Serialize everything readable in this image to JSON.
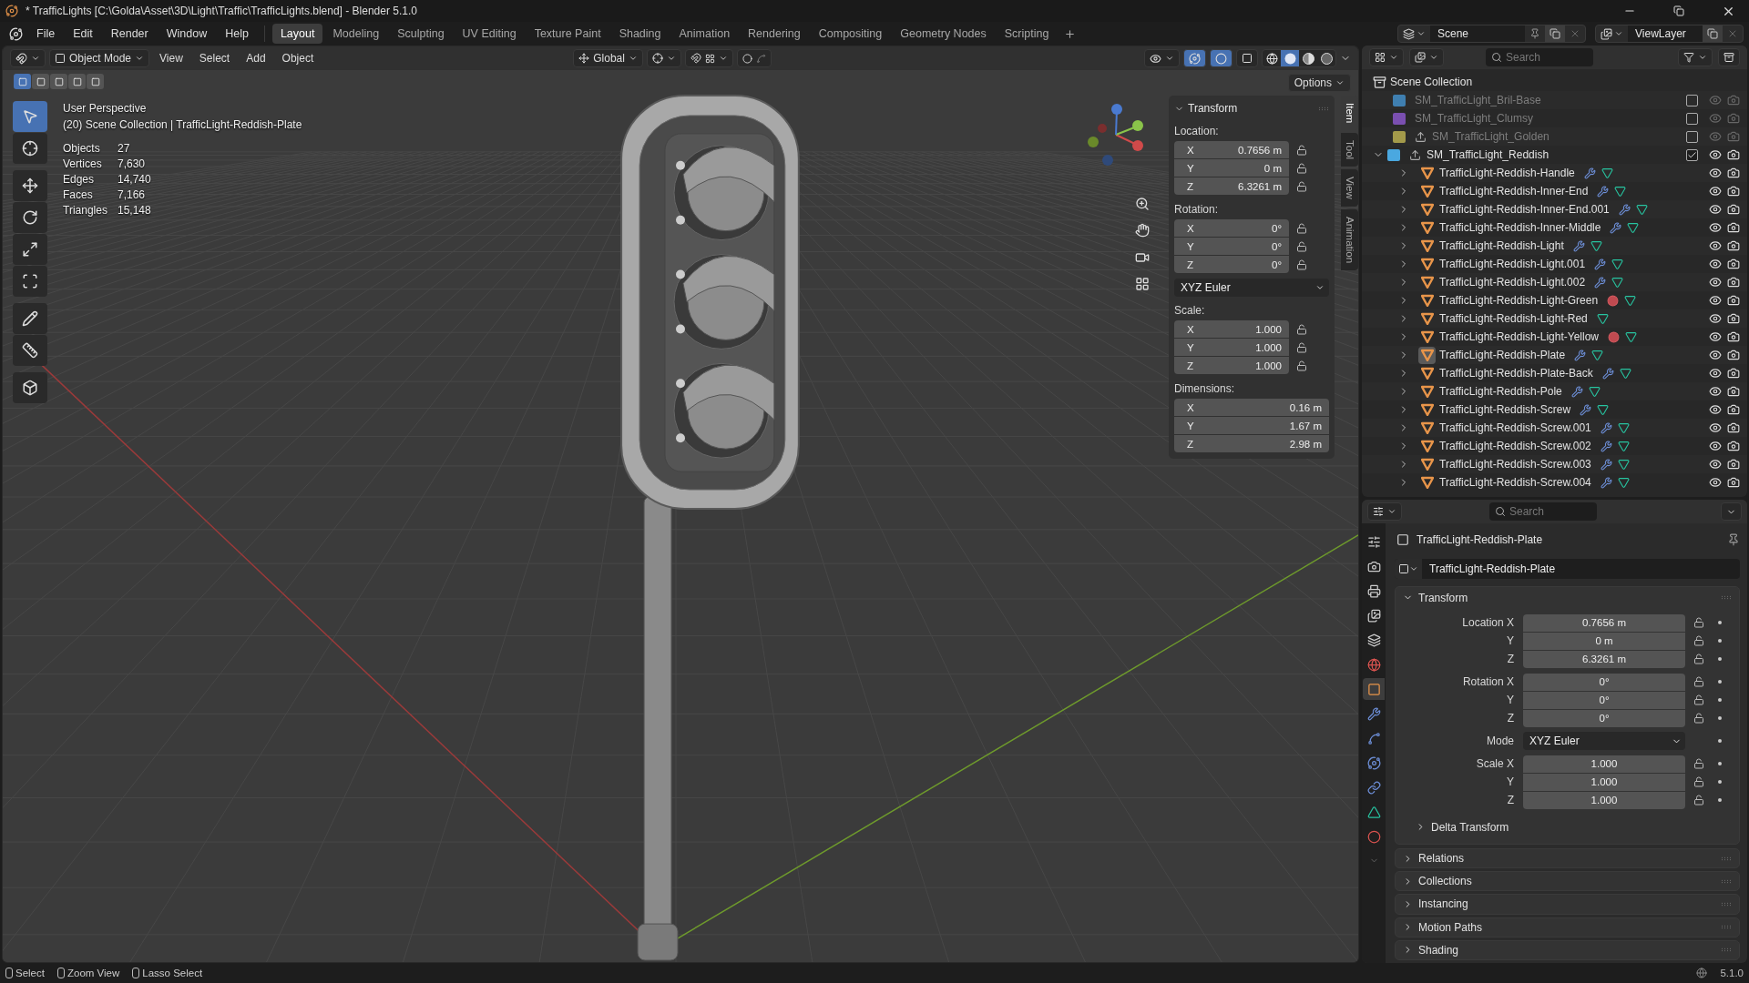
{
  "window": {
    "title": "* TrafficLights [C:\\Golda\\Asset\\3D\\Light\\Traffic\\TrafficLights.blend] - Blender 5.1.0"
  },
  "menu": [
    "File",
    "Edit",
    "Render",
    "Window",
    "Help"
  ],
  "workspaces": [
    {
      "label": "Layout",
      "selected": true
    },
    {
      "label": "Modeling",
      "selected": false
    },
    {
      "label": "Sculpting",
      "selected": false
    },
    {
      "label": "UV Editing",
      "selected": false
    },
    {
      "label": "Texture Paint",
      "selected": false
    },
    {
      "label": "Shading",
      "selected": false
    },
    {
      "label": "Animation",
      "selected": false
    },
    {
      "label": "Rendering",
      "selected": false
    },
    {
      "label": "Compositing",
      "selected": false
    },
    {
      "label": "Geometry Nodes",
      "selected": false
    },
    {
      "label": "Scripting",
      "selected": false
    }
  ],
  "scene_selector": {
    "scene": "Scene",
    "view_layer": "ViewLayer"
  },
  "viewport": {
    "mode": "Object Mode",
    "menus": [
      "View",
      "Select",
      "Add",
      "Object"
    ],
    "orientation": "Global",
    "options": "Options",
    "shading": [
      {
        "kind": "wireframe",
        "selected": false
      },
      {
        "kind": "solid",
        "selected": true
      },
      {
        "kind": "material",
        "selected": false
      },
      {
        "kind": "rendered",
        "selected": false
      }
    ],
    "select_modes": [
      {
        "selected": true
      },
      {
        "selected": false
      },
      {
        "selected": false
      },
      {
        "selected": false
      },
      {
        "selected": false
      }
    ],
    "tools": [
      {
        "kind": "select",
        "selected": true
      },
      {
        "kind": "cursor",
        "selected": false
      },
      {
        "kind": "move",
        "selected": false
      },
      {
        "kind": "rotate",
        "selected": false
      },
      {
        "kind": "scale",
        "selected": false
      },
      {
        "kind": "transform",
        "selected": false
      },
      {
        "kind": "annotate",
        "selected": false
      },
      {
        "kind": "measure",
        "selected": false
      },
      {
        "kind": "add_cube",
        "selected": false
      }
    ],
    "view_name": "User Perspective",
    "context": "(20) Scene Collection | TrafficLight-Reddish-Plate",
    "stats": [
      {
        "label": "Objects",
        "value": "27"
      },
      {
        "label": "Vertices",
        "value": "7,630"
      },
      {
        "label": "Edges",
        "value": "14,740"
      },
      {
        "label": "Faces",
        "value": "7,166"
      },
      {
        "label": "Triangles",
        "value": "15,148"
      }
    ]
  },
  "sidebar": {
    "tabs": [
      {
        "label": "Item",
        "selected": true
      },
      {
        "label": "Tool",
        "selected": false
      },
      {
        "label": "View",
        "selected": false
      },
      {
        "label": "Animation",
        "selected": false
      }
    ],
    "panel_title": "Transform",
    "groups": [
      {
        "label": "Location:",
        "lockable": true,
        "rows": [
          {
            "axis": "X",
            "value": "0.7656 m"
          },
          {
            "axis": "Y",
            "value": "0 m"
          },
          {
            "axis": "Z",
            "value": "6.3261 m"
          }
        ]
      },
      {
        "label": "Rotation:",
        "lockable": true,
        "rows": [
          {
            "axis": "X",
            "value": "0°"
          },
          {
            "axis": "Y",
            "value": "0°"
          },
          {
            "axis": "Z",
            "value": "0°"
          }
        ],
        "mode": "XYZ Euler"
      },
      {
        "label": "Scale:",
        "lockable": true,
        "rows": [
          {
            "axis": "X",
            "value": "1.000"
          },
          {
            "axis": "Y",
            "value": "1.000"
          },
          {
            "axis": "Z",
            "value": "1.000"
          }
        ]
      },
      {
        "label": "Dimensions:",
        "lockable": false,
        "rows": [
          {
            "axis": "X",
            "value": "0.16 m"
          },
          {
            "axis": "Y",
            "value": "1.67 m"
          },
          {
            "axis": "Z",
            "value": "2.98 m"
          }
        ]
      }
    ]
  },
  "outliner": {
    "search_placeholder": "Search",
    "root": "Scene Collection",
    "items": [
      {
        "name": "SM_TrafficLight_Bril-Base",
        "color": "#3f7fb0",
        "checked": false,
        "has_empty": false
      },
      {
        "name": "SM_TrafficLight_Clumsy",
        "color": "#7a4fb0",
        "checked": false,
        "has_empty": false
      },
      {
        "name": "SM_TrafficLight_Golden",
        "color": "#a39a4a",
        "checked": false,
        "has_empty": true
      },
      {
        "name": "SM_TrafficLight_Reddish",
        "color": "#4aa8e0",
        "checked": true,
        "has_empty": true,
        "expanded": true,
        "children": [
          {
            "name": "TrafficLight-Reddish-Handle",
            "modifier": true,
            "material": false,
            "selected": false
          },
          {
            "name": "TrafficLight-Reddish-Inner-End",
            "modifier": true,
            "material": false,
            "selected": false
          },
          {
            "name": "TrafficLight-Reddish-Inner-End.001",
            "modifier": true,
            "material": false,
            "selected": false
          },
          {
            "name": "TrafficLight-Reddish-Inner-Middle",
            "modifier": true,
            "material": false,
            "selected": false
          },
          {
            "name": "TrafficLight-Reddish-Light",
            "modifier": true,
            "material": false,
            "selected": false
          },
          {
            "name": "TrafficLight-Reddish-Light.001",
            "modifier": true,
            "material": false,
            "selected": false
          },
          {
            "name": "TrafficLight-Reddish-Light.002",
            "modifier": true,
            "material": false,
            "selected": false
          },
          {
            "name": "TrafficLight-Reddish-Light-Green",
            "modifier": false,
            "material": true,
            "selected": false
          },
          {
            "name": "TrafficLight-Reddish-Light-Red",
            "modifier": false,
            "material": false,
            "selected": false
          },
          {
            "name": "TrafficLight-Reddish-Light-Yellow",
            "modifier": false,
            "material": true,
            "selected": false
          },
          {
            "name": "TrafficLight-Reddish-Plate",
            "modifier": true,
            "material": false,
            "selected": true
          },
          {
            "name": "TrafficLight-Reddish-Plate-Back",
            "modifier": true,
            "material": false,
            "selected": false
          },
          {
            "name": "TrafficLight-Reddish-Pole",
            "modifier": true,
            "material": false,
            "selected": false
          },
          {
            "name": "TrafficLight-Reddish-Screw",
            "modifier": true,
            "material": false,
            "selected": false
          },
          {
            "name": "TrafficLight-Reddish-Screw.001",
            "modifier": true,
            "material": false,
            "selected": false
          },
          {
            "name": "TrafficLight-Reddish-Screw.002",
            "modifier": true,
            "material": false,
            "selected": false
          },
          {
            "name": "TrafficLight-Reddish-Screw.003",
            "modifier": true,
            "material": false,
            "selected": false
          },
          {
            "name": "TrafficLight-Reddish-Screw.004",
            "modifier": true,
            "material": false,
            "selected": false
          }
        ]
      }
    ]
  },
  "properties": {
    "search_placeholder": "Search",
    "tabs": [
      {
        "kind": "tool",
        "selected": false
      },
      {
        "kind": "render",
        "selected": false
      },
      {
        "kind": "output",
        "selected": false
      },
      {
        "kind": "view_layer",
        "selected": false
      },
      {
        "kind": "scene",
        "selected": false
      },
      {
        "kind": "world",
        "selected": false
      },
      {
        "kind": "object",
        "selected": true
      },
      {
        "kind": "modifiers",
        "selected": false
      },
      {
        "kind": "particles",
        "selected": false
      },
      {
        "kind": "physics",
        "selected": false
      },
      {
        "kind": "constraints",
        "selected": false
      },
      {
        "kind": "data",
        "selected": false
      },
      {
        "kind": "material",
        "selected": false
      }
    ],
    "object_name": "TrafficLight-Reddish-Plate",
    "data_name": "TrafficLight-Reddish-Plate",
    "panel_title": "Transform",
    "groups": [
      [
        {
          "label": "Location X",
          "value": "0.7656 m",
          "kind": "number"
        },
        {
          "label": "Y",
          "value": "0 m",
          "kind": "number"
        },
        {
          "label": "Z",
          "value": "6.3261 m",
          "kind": "number"
        }
      ],
      [
        {
          "label": "Rotation X",
          "value": "0°",
          "kind": "number"
        },
        {
          "label": "Y",
          "value": "0°",
          "kind": "number"
        },
        {
          "label": "Z",
          "value": "0°",
          "kind": "number"
        }
      ],
      [
        {
          "label": "Mode",
          "value": "XYZ Euler",
          "kind": "dropdown"
        }
      ],
      [
        {
          "label": "Scale X",
          "value": "1.000",
          "kind": "number"
        },
        {
          "label": "Y",
          "value": "1.000",
          "kind": "number"
        },
        {
          "label": "Z",
          "value": "1.000",
          "kind": "number"
        }
      ]
    ],
    "subpanel": "Delta Transform",
    "panels": [
      "Relations",
      "Collections",
      "Instancing",
      "Motion Paths",
      "Shading"
    ]
  },
  "status_bar": {
    "hints": [
      "Select",
      "Zoom View",
      "Lasso Select"
    ],
    "version": "5.1.0"
  }
}
